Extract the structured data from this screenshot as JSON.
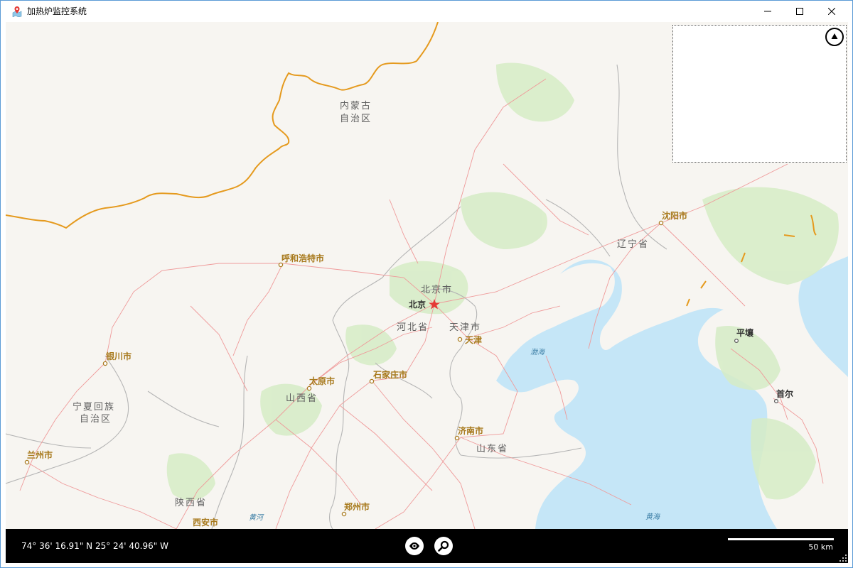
{
  "window": {
    "title": "加热炉监控系统"
  },
  "map": {
    "labels": {
      "nei_menggu_1": "内蒙古",
      "nei_menggu_2": "自治区",
      "huhehaote": "呼和浩特市",
      "beijing_shi": "北京市",
      "beijing": "北京",
      "hebei": "河北省",
      "tianjin_shi": "天津市",
      "tianjin": "天津",
      "shenyang": "沈阳市",
      "liaoning": "辽宁省",
      "bohai": "渤海",
      "pyongyang": "平壤",
      "seoul": "首尔",
      "yinchuan": "银川市",
      "taiyuan": "太原市",
      "shijiazhuang": "石家庄市",
      "shanxi": "山西省",
      "ningxia_1": "宁夏回族",
      "ningxia_2": "自治区",
      "lanzhou": "兰州市",
      "jinan": "济南市",
      "shandong": "山东省",
      "shaanxi": "陕西省",
      "xian": "西安市",
      "zhengzhou": "郑州市",
      "huanghe": "黄河",
      "huanghai": "黄海"
    }
  },
  "status": {
    "coordinates": "74° 36' 16.91\" N 25° 24' 40.96\" W",
    "scale_label": "50 km"
  },
  "icons": {
    "app": "map-pin-icon",
    "minimize": "minimize-icon",
    "maximize": "maximize-icon",
    "close": "close-icon",
    "overview_toggle": "triangle-up-icon",
    "eye": "eye-icon",
    "search": "magnifier-icon"
  },
  "colors": {
    "land": "#f7f5f1",
    "sea": "#c5e6f7",
    "forest": "#d6ecc6",
    "road": "#ef9a9a",
    "border": "#b5b5b5",
    "national_border": "#e59a1e",
    "city_label": "#a87a1d",
    "statusbar": "#000000"
  }
}
